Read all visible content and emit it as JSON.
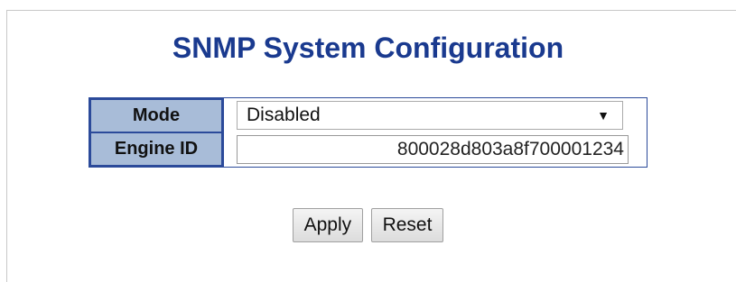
{
  "page": {
    "title": "SNMP System Configuration"
  },
  "form": {
    "mode": {
      "label": "Mode",
      "selected_value": "Disabled",
      "arrow_icon": "dropdown-arrow-icon"
    },
    "engine_id": {
      "label": "Engine ID",
      "value": "800028d803a8f700001234"
    }
  },
  "buttons": {
    "apply_label": "Apply",
    "reset_label": "Reset"
  },
  "colors": {
    "title": "#1a3a8f",
    "label_cell_bg": "#a8bcd8",
    "table_border": "#2b4a9a"
  }
}
